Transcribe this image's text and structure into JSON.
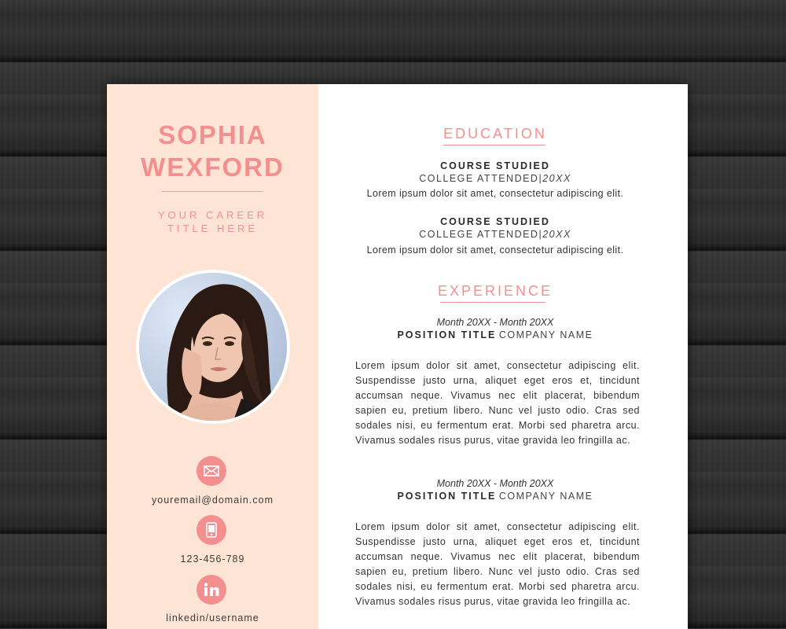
{
  "resume": {
    "first_name": "SOPHIA",
    "last_name": "WEXFORD",
    "career_line1": "YOUR CAREER",
    "career_line2": "TITLE HERE",
    "contacts": {
      "email": "youremail@domain.com",
      "phone": "123-456-789",
      "linkedin": "linkedin/username"
    },
    "education": {
      "title": "EDUCATION",
      "items": [
        {
          "course": "COURSE STUDIED",
          "college": "COLLEGE ATTENDED",
          "year": "20XX",
          "description": "Lorem ipsum dolor sit amet, consectetur adipiscing elit."
        },
        {
          "course": "COURSE STUDIED",
          "college": "COLLEGE ATTENDED",
          "year": "20XX",
          "description": "Lorem ipsum dolor sit amet, consectetur adipiscing elit."
        }
      ]
    },
    "experience": {
      "title": "EXPERIENCE",
      "items": [
        {
          "dates": "Month 20XX - Month 20XX",
          "position": "POSITION TITLE",
          "company": "COMPANY NAME",
          "description": "Lorem ipsum dolor sit amet, consectetur adipiscing elit. Suspendisse justo urna, aliquet eget eros et, tincidunt accumsan neque. Vivamus nec elit placerat, bibendum sapien eu, pretium libero. Nunc vel justo odio. Cras sed sodales nisi, eu fermentum erat. Morbi sed pharetra arcu. Vivamus sodales risus purus, vitae gravida leo fringilla ac."
        },
        {
          "dates": "Month 20XX - Month 20XX",
          "position": "POSITION TITLE",
          "company": "COMPANY NAME",
          "description": "Lorem ipsum dolor sit amet, consectetur adipiscing elit. Suspendisse justo urna, aliquet eget eros et, tincidunt accumsan neque. Vivamus nec elit placerat, bibendum sapien eu, pretium libero. Nunc vel justo odio. Cras sed sodales nisi, eu fermentum erat. Morbi sed pharetra arcu. Vivamus sodales risus purus, vitae gravida leo fringilla ac."
        }
      ]
    },
    "icons": [
      "envelope-icon",
      "phone-icon",
      "linkedin-icon"
    ],
    "colors": {
      "accent": "#f48f90",
      "sidebar": "#fde4d4",
      "text": "#333333"
    }
  }
}
